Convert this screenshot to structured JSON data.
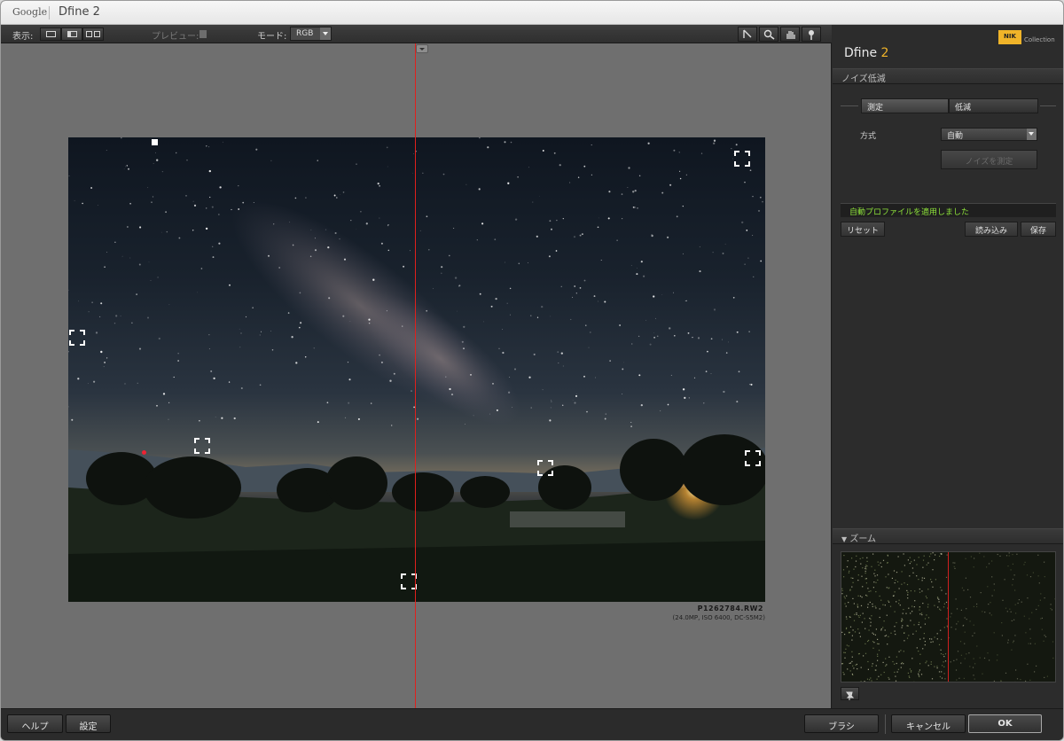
{
  "window": {
    "brand": "Google",
    "title": "Dfine 2"
  },
  "toolbar": {
    "view_label": "表示:",
    "preview_label": "プレビュー:",
    "mode_label": "モード:",
    "mode_value": "RGB"
  },
  "image": {
    "filename": "P1262784.RW2",
    "info": "(24.0MP, ISO 6400, DC-S5M2)"
  },
  "panel": {
    "logo": "NIK",
    "logo_text": "Collection",
    "title_main": "Dfine",
    "title_num": "2",
    "section_noise": "ノイズ低減",
    "tab_measure": "測定",
    "tab_reduce": "低減",
    "method_label": "方式",
    "method_value": "自動",
    "measure_button": "ノイズを測定",
    "status": "自動プロファイルを適用しました",
    "reset_button": "リセット",
    "load_button": "読み込み",
    "save_button": "保存",
    "section_zoom": "ズーム"
  },
  "bottom": {
    "help": "ヘルプ",
    "settings": "設定",
    "brush": "ブラシ",
    "cancel": "キャンセル",
    "ok": "OK"
  },
  "colors": {
    "accent": "#f0b429",
    "status_green": "#8de23a",
    "split_line": "#e0201c"
  }
}
